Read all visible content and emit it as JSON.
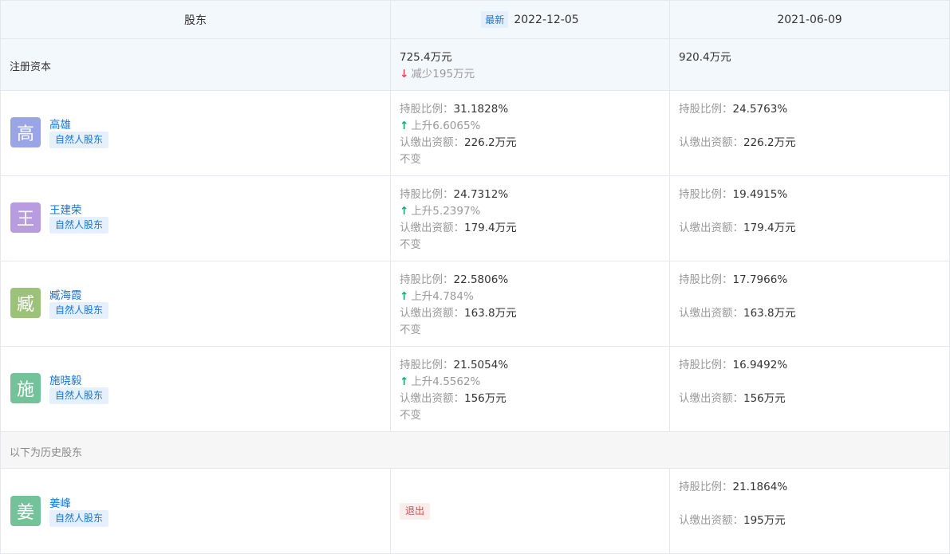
{
  "header": {
    "col_shareholder": "股东",
    "latest_badge": "最新",
    "date_current": "2022-12-05",
    "date_previous": "2021-06-09"
  },
  "registered_capital": {
    "label": "注册资本",
    "current": "725.4万元",
    "change": "减少195万元",
    "previous": "920.4万元"
  },
  "labels": {
    "ratio": "持股比例：",
    "capital": "认缴出资额：",
    "tag": "自然人股东",
    "unchanged": "不变",
    "history_divider": "以下为历史股东",
    "exit": "退出"
  },
  "shareholders": [
    {
      "avatar_char": "高",
      "avatar_color": "#9aa5e8",
      "name": "高雄",
      "cur_ratio": "31.1828%",
      "cur_change": "上升6.6065%",
      "cur_capital": "226.2万元",
      "cap_change": "不变",
      "prev_ratio": "24.5763%",
      "prev_capital": "226.2万元"
    },
    {
      "avatar_char": "王",
      "avatar_color": "#b99be0",
      "name": "王建荣",
      "cur_ratio": "24.7312%",
      "cur_change": "上升5.2397%",
      "cur_capital": "179.4万元",
      "cap_change": "不变",
      "prev_ratio": "19.4915%",
      "prev_capital": "179.4万元"
    },
    {
      "avatar_char": "臧",
      "avatar_color": "#9cc27a",
      "name": "臧海霞",
      "cur_ratio": "22.5806%",
      "cur_change": "上升4.784%",
      "cur_capital": "163.8万元",
      "cap_change": "不变",
      "prev_ratio": "17.7966%",
      "prev_capital": "163.8万元"
    },
    {
      "avatar_char": "施",
      "avatar_color": "#74c29a",
      "name": "施晓毅",
      "cur_ratio": "21.5054%",
      "cur_change": "上升4.5562%",
      "cur_capital": "156万元",
      "cap_change": "不变",
      "prev_ratio": "16.9492%",
      "prev_capital": "156万元"
    }
  ],
  "historical": [
    {
      "avatar_char": "姜",
      "avatar_color": "#74c29a",
      "name": "姜峰",
      "prev_ratio": "21.1864%",
      "prev_capital": "195万元"
    }
  ]
}
